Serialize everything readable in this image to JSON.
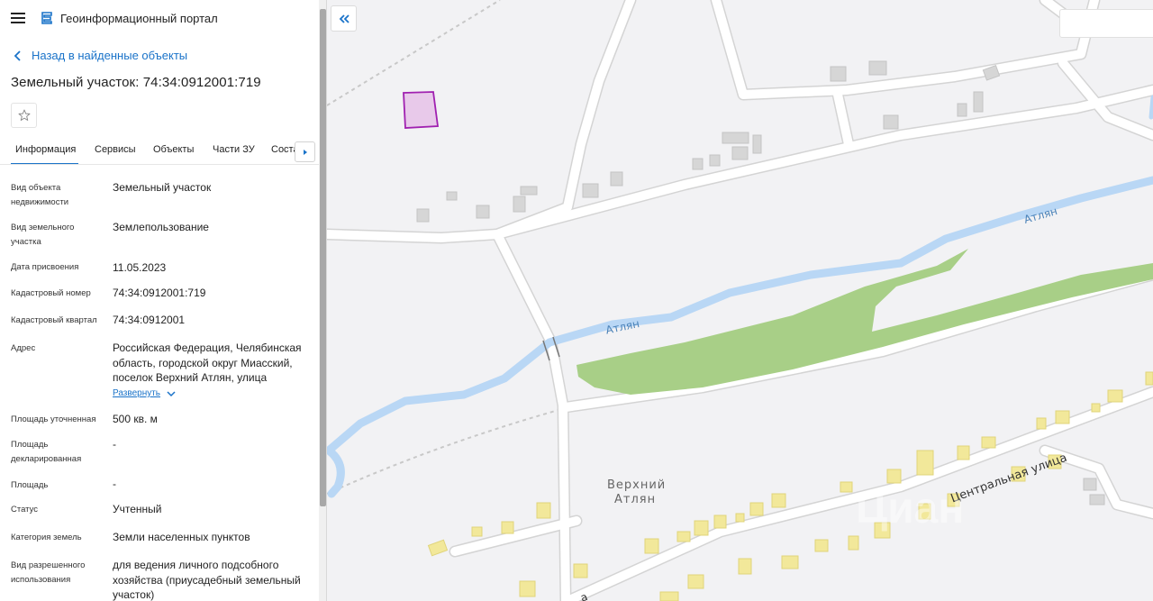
{
  "app": {
    "title": "Геоинформационный портал"
  },
  "nav": {
    "back_label": "Назад в найденные объекты"
  },
  "object": {
    "title": "Земельный участок: 74:34:0912001:719"
  },
  "tabs": [
    {
      "label": "Информация"
    },
    {
      "label": "Сервисы"
    },
    {
      "label": "Объекты"
    },
    {
      "label": "Части ЗУ"
    },
    {
      "label": "Соста"
    }
  ],
  "details": {
    "object_type": {
      "label": "Вид объекта недвижимости",
      "value": "Земельный участок"
    },
    "land_type": {
      "label": "Вид земельного участка",
      "value": "Землепользование"
    },
    "assign_date": {
      "label": "Дата присвоения",
      "value": "11.05.2023"
    },
    "cadastral_number": {
      "label": "Кадастровый номер",
      "value": "74:34:0912001:719"
    },
    "cadastral_quarter": {
      "label": "Кадастровый квартал",
      "value": "74:34:0912001"
    },
    "address": {
      "label": "Адрес",
      "value": "Российская Федерация, Челябинская область, городской округ Миасский, поселок Верхний Атлян, улица",
      "expand_label": "Развернуть"
    },
    "area_specified": {
      "label": "Площадь уточненная",
      "value": "500 кв. м"
    },
    "area_declared": {
      "label": "Площадь декларированная",
      "value": "-"
    },
    "area": {
      "label": "Площадь",
      "value": "-"
    },
    "status": {
      "label": "Статус",
      "value": "Учтенный"
    },
    "land_category": {
      "label": "Категория земель",
      "value": "Земли населенных пунктов"
    },
    "permitted_use": {
      "label": "Вид разрешенного использования",
      "value": "для ведения личного подсобного хозяйства (приусадебный земельный участок)"
    }
  },
  "map": {
    "river_label_1": "Атлян",
    "river_label_2": "Атлян",
    "settlement_label_1": "Верхний",
    "settlement_label_2": "Атлян",
    "street_label": "Центральная улица",
    "street_label_partial": "а",
    "watermark": "Циан"
  },
  "colors": {
    "accent": "#1a73c9",
    "river": "#b9d7f5",
    "forest": "#a8cf87",
    "parcel_fill": "#e8c9ea",
    "parcel_stroke": "#a020b0",
    "building": "#d6d6d6",
    "building_yellow": "#f2e89a",
    "road": "#ffffff"
  }
}
